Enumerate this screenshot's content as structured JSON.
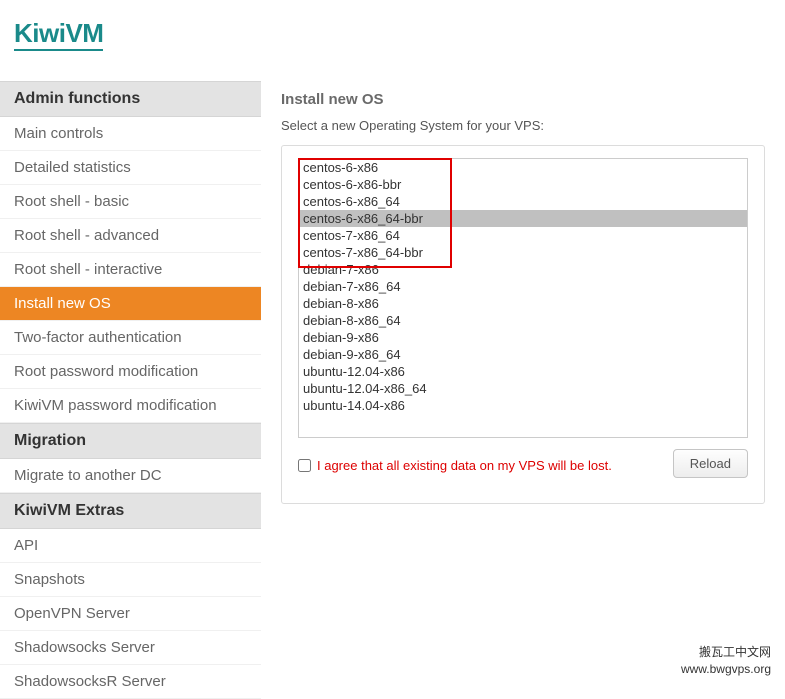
{
  "header": {
    "logo": "KiwiVM"
  },
  "sidebar": {
    "sections": [
      {
        "title": "Admin functions",
        "items": [
          {
            "label": "Main controls",
            "active": false
          },
          {
            "label": "Detailed statistics",
            "active": false
          },
          {
            "label": "Root shell - basic",
            "active": false
          },
          {
            "label": "Root shell - advanced",
            "active": false
          },
          {
            "label": "Root shell - interactive",
            "active": false
          },
          {
            "label": "Install new OS",
            "active": true
          },
          {
            "label": "Two-factor authentication",
            "active": false
          },
          {
            "label": "Root password modification",
            "active": false
          },
          {
            "label": "KiwiVM password modification",
            "active": false
          }
        ]
      },
      {
        "title": "Migration",
        "items": [
          {
            "label": "Migrate to another DC",
            "active": false
          }
        ]
      },
      {
        "title": "KiwiVM Extras",
        "items": [
          {
            "label": "API",
            "active": false
          },
          {
            "label": "Snapshots",
            "active": false
          },
          {
            "label": "OpenVPN Server",
            "active": false
          },
          {
            "label": "Shadowsocks Server",
            "active": false
          },
          {
            "label": "ShadowsocksR Server",
            "active": false
          }
        ]
      }
    ]
  },
  "content": {
    "title": "Install new OS",
    "subtitle": "Select a new Operating System for your VPS:",
    "os_options": [
      "centos-6-x86",
      "centos-6-x86-bbr",
      "centos-6-x86_64",
      "centos-6-x86_64-bbr",
      "centos-7-x86_64",
      "centos-7-x86_64-bbr",
      "debian-7-x86",
      "debian-7-x86_64",
      "debian-8-x86",
      "debian-8-x86_64",
      "debian-9-x86",
      "debian-9-x86_64",
      "ubuntu-12.04-x86",
      "ubuntu-12.04-x86_64",
      "ubuntu-14.04-x86"
    ],
    "selected_index": 3,
    "agree_label": "I agree that all existing data on my VPS will be lost.",
    "reload_label": "Reload"
  },
  "watermark_corner": {
    "cn": "搬瓦工中文网",
    "url": "www.bwgvps.org"
  }
}
